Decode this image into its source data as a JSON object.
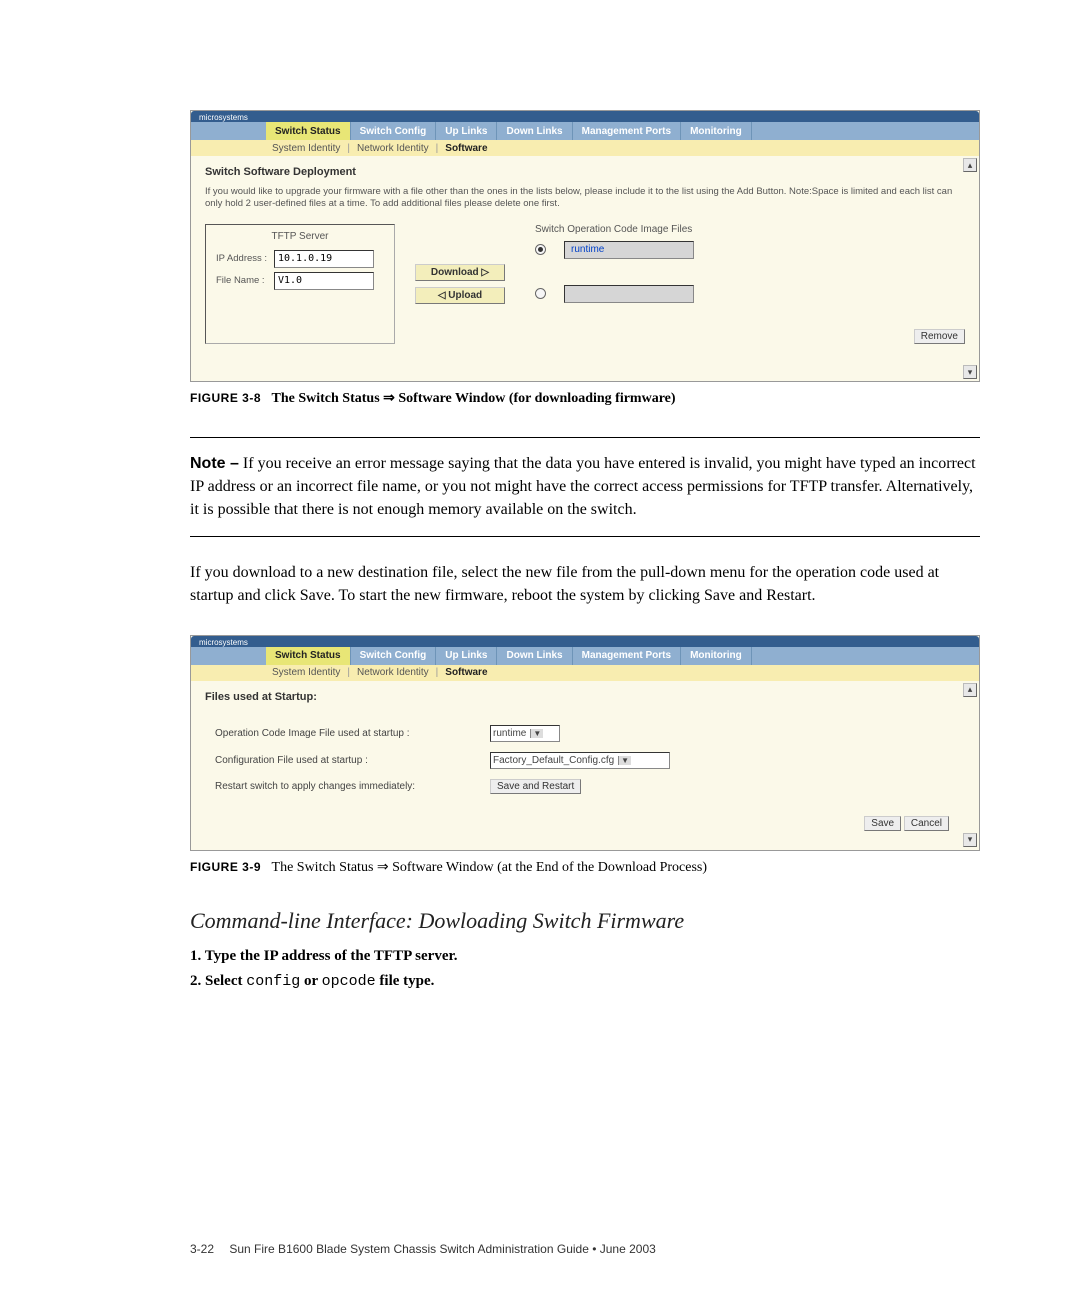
{
  "shot1": {
    "brand": "microsystems",
    "tabs": [
      "Switch Status",
      "Switch Config",
      "Up Links",
      "Down Links",
      "Management Ports",
      "Monitoring"
    ],
    "subtabs": [
      "System Identity",
      "Network Identity",
      "Software"
    ],
    "title": "Switch Software Deployment",
    "desc": "If you would like to upgrade your firmware with a file other than the ones in the lists below, please include it to the list using the Add Button. Note:Space is limited and each list can only hold 2 user-defined files at a time. To add additional files please delete one first.",
    "tftp_legend": "TFTP Server",
    "ip_label": "IP Address :",
    "ip_value": "10.1.0.19",
    "file_label": "File Name  :",
    "file_value": "V1.0",
    "download_btn": "Download  ▷",
    "upload_btn": "◁ Upload",
    "right_title": "Switch Operation Code Image Files",
    "runtime_label": "runtime",
    "remove_btn": "Remove"
  },
  "cap1": {
    "label": "FIGURE 3-8",
    "text": "The Switch Status ⇒ Software Window (for downloading firmware)"
  },
  "note": {
    "label": "Note –",
    "text": " If you receive an error message saying that the data you have entered is invalid, you might have typed an incorrect IP address or an incorrect file name, or you not might have the correct access permissions for TFTP transfer. Alternatively, it is possible that there is not enough memory available on the switch."
  },
  "para": "If you download to a new destination file, select the new file from the pull-down menu for the operation code used at startup and click Save. To start the new firmware, reboot the system by clicking Save and Restart.",
  "shot2": {
    "title": "Files used at Startup:",
    "row1_label": "Operation Code Image File used at startup :",
    "row1_value": "runtime",
    "row2_label": "Configuration File used at startup :",
    "row2_value": "Factory_Default_Config.cfg",
    "row3_label": "Restart switch to apply changes immediately:",
    "save_restart_btn": "Save and Restart",
    "save_btn": "Save",
    "cancel_btn": "Cancel"
  },
  "cap2": {
    "label": "FIGURE 3-9",
    "text": "The Switch Status ⇒ Software Window (at the End of the Download Process)"
  },
  "cli_heading": "Command-line Interface: Dowloading Switch Firmware",
  "step1": "1. Type the IP address of the TFTP server.",
  "step2a": "2. Select ",
  "step2b": "config",
  "step2c": " or ",
  "step2d": "opcode",
  "step2e": " file type.",
  "footer": {
    "page": "3-22",
    "title": "Sun Fire B1600 Blade System Chassis Switch Administration Guide • June 2003"
  }
}
